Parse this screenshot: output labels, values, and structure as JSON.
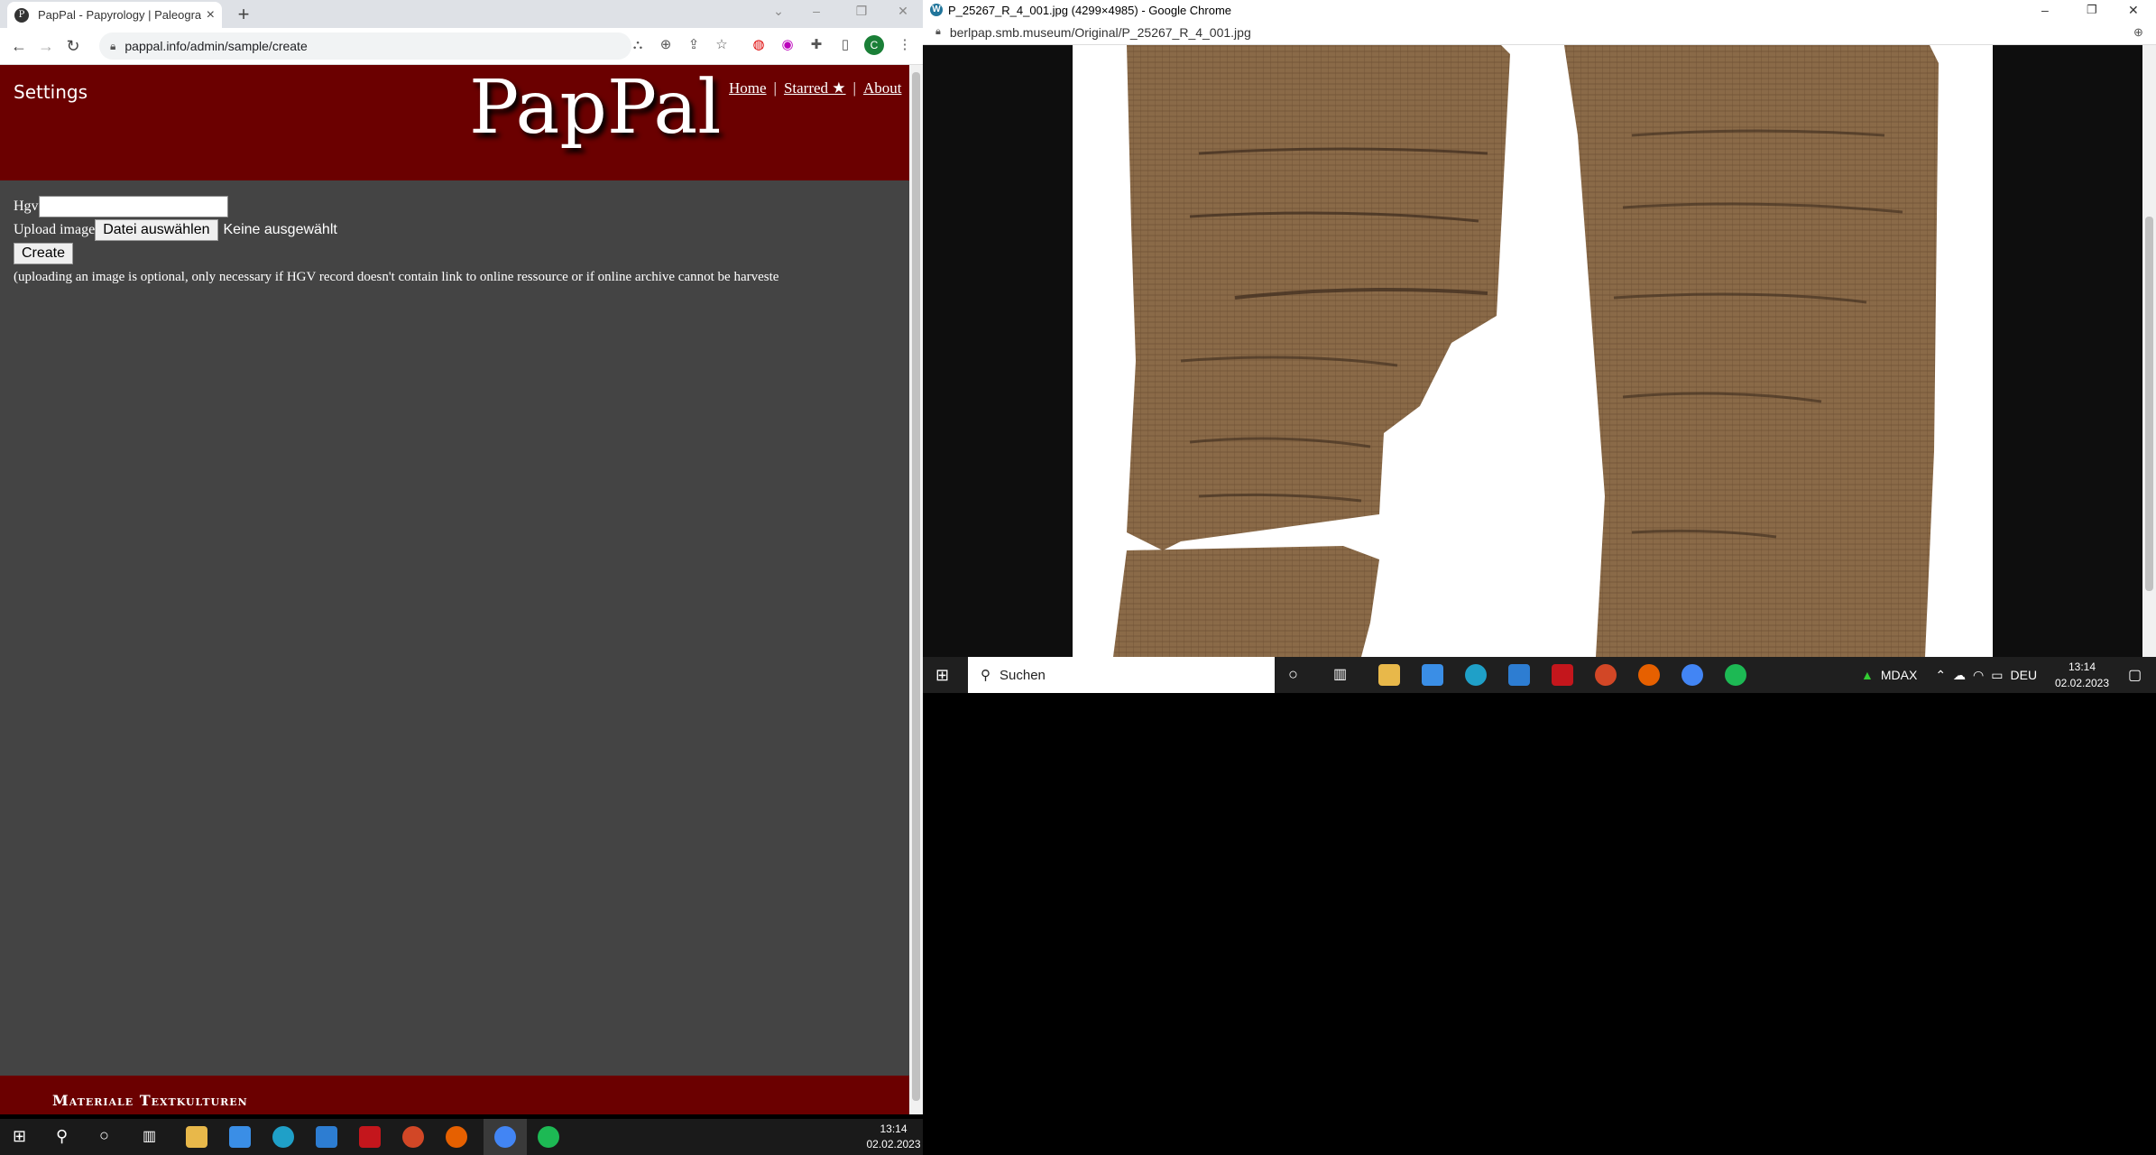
{
  "left_browser": {
    "tab_title": "PapPal - Papyrology | Paleograph",
    "url": "pappal.info/admin/sample/create",
    "profile_initial": "C"
  },
  "page": {
    "settings_label": "Settings",
    "brand": "PapPal",
    "nav": {
      "home": "Home",
      "starred": "Starred ★",
      "about": "About"
    },
    "form": {
      "hgv_label": "Hgv",
      "hgv_value": "",
      "upload_label": "Upload image",
      "choose_file_label": "Datei auswählen",
      "no_file_label": "Keine ausgewählt",
      "create_label": "Create",
      "note": "(uploading an image is optional, only necessary if HGV record doesn't contain link to online ressource or if online archive cannot be harveste"
    },
    "footer_text": "Materiale Textkulturen"
  },
  "right_browser": {
    "window_title": "P_25267_R_4_001.jpg (4299×4985) - Google Chrome",
    "url": "berlpap.smb.museum/Original/P_25267_R_4_001.jpg",
    "taskbar": {
      "search_placeholder": "Suchen",
      "tray_label": "MDAX",
      "lang": "DEU",
      "time": "13:14",
      "date": "02.02.2023"
    }
  },
  "taskbar": {
    "time": "13:14",
    "date": "02.02.2023"
  },
  "colors": {
    "header_bg": "#6b0000",
    "page_bg": "#444444",
    "papyrus": "#8a6a48"
  }
}
